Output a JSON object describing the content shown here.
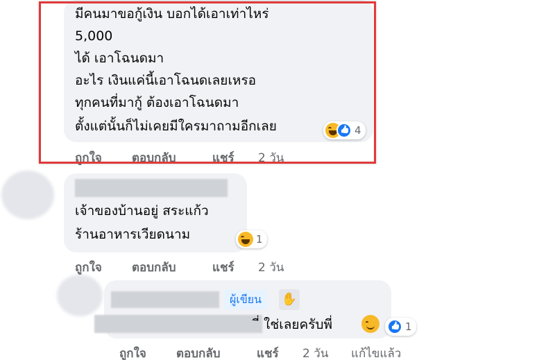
{
  "comment1": {
    "lines": [
      "มีคนมาขอกู้เงิน บอกได้เอาเท่าไหร่",
      "5,000",
      "ได้ เอาโฉนดมา",
      "อะไร เงินแค่นี้เอาโฉนดเลยเหรอ",
      "ทุกคนที่มากู้ ต้องเอาโฉนดมา",
      "ตั้งแต่นั้นก็ไม่เคยมีใครมาถามอีกเลย"
    ],
    "reaction_count": "4",
    "actions": {
      "like": "ถูกใจ",
      "reply": "ตอบกลับ",
      "share": "แชร์",
      "time": "2 วัน"
    }
  },
  "comment2": {
    "lines": [
      "เจ้าของบ้านอยู่ สระแก้ว",
      "ร้านอาหารเวียดนาม"
    ],
    "reaction_count": "1",
    "actions": {
      "like": "ถูกใจ",
      "reply": "ตอบกลับ",
      "share": "แชร์",
      "time": "2 วัน"
    }
  },
  "reply1": {
    "author_badge": "ผู้เขียน",
    "text_tail": "ี่ ใช่เลยครับพี่",
    "reaction_count": "1",
    "actions": {
      "like": "ถูกใจ",
      "reply": "ตอบกลับ",
      "share": "แชร์",
      "time": "2 วัน",
      "edited": "แก้ไขแล้ว"
    }
  },
  "icons": {
    "haha": "haha-reaction-icon",
    "like": "like-reaction-icon",
    "smile": "smile-emoji-icon",
    "wave": "waving-hand-icon"
  },
  "colors": {
    "highlight": "#e03a3a",
    "bubble": "#f0f2f5",
    "meta_text": "#65676b",
    "author_badge": "#1877f2"
  }
}
